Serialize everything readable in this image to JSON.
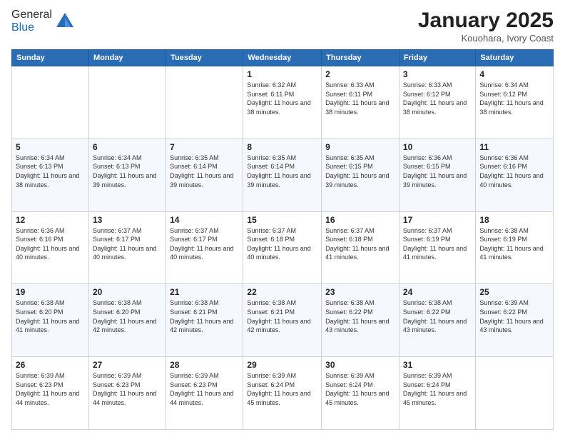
{
  "header": {
    "logo_general": "General",
    "logo_blue": "Blue",
    "month_title": "January 2025",
    "location": "Kouohara, Ivory Coast"
  },
  "days_of_week": [
    "Sunday",
    "Monday",
    "Tuesday",
    "Wednesday",
    "Thursday",
    "Friday",
    "Saturday"
  ],
  "weeks": [
    [
      {
        "day": "",
        "info": ""
      },
      {
        "day": "",
        "info": ""
      },
      {
        "day": "",
        "info": ""
      },
      {
        "day": "1",
        "info": "Sunrise: 6:32 AM\nSunset: 6:11 PM\nDaylight: 11 hours\nand 38 minutes."
      },
      {
        "day": "2",
        "info": "Sunrise: 6:33 AM\nSunset: 6:11 PM\nDaylight: 11 hours\nand 38 minutes."
      },
      {
        "day": "3",
        "info": "Sunrise: 6:33 AM\nSunset: 6:12 PM\nDaylight: 11 hours\nand 38 minutes."
      },
      {
        "day": "4",
        "info": "Sunrise: 6:34 AM\nSunset: 6:12 PM\nDaylight: 11 hours\nand 38 minutes."
      }
    ],
    [
      {
        "day": "5",
        "info": "Sunrise: 6:34 AM\nSunset: 6:13 PM\nDaylight: 11 hours\nand 38 minutes."
      },
      {
        "day": "6",
        "info": "Sunrise: 6:34 AM\nSunset: 6:13 PM\nDaylight: 11 hours\nand 39 minutes."
      },
      {
        "day": "7",
        "info": "Sunrise: 6:35 AM\nSunset: 6:14 PM\nDaylight: 11 hours\nand 39 minutes."
      },
      {
        "day": "8",
        "info": "Sunrise: 6:35 AM\nSunset: 6:14 PM\nDaylight: 11 hours\nand 39 minutes."
      },
      {
        "day": "9",
        "info": "Sunrise: 6:35 AM\nSunset: 6:15 PM\nDaylight: 11 hours\nand 39 minutes."
      },
      {
        "day": "10",
        "info": "Sunrise: 6:36 AM\nSunset: 6:15 PM\nDaylight: 11 hours\nand 39 minutes."
      },
      {
        "day": "11",
        "info": "Sunrise: 6:36 AM\nSunset: 6:16 PM\nDaylight: 11 hours\nand 40 minutes."
      }
    ],
    [
      {
        "day": "12",
        "info": "Sunrise: 6:36 AM\nSunset: 6:16 PM\nDaylight: 11 hours\nand 40 minutes."
      },
      {
        "day": "13",
        "info": "Sunrise: 6:37 AM\nSunset: 6:17 PM\nDaylight: 11 hours\nand 40 minutes."
      },
      {
        "day": "14",
        "info": "Sunrise: 6:37 AM\nSunset: 6:17 PM\nDaylight: 11 hours\nand 40 minutes."
      },
      {
        "day": "15",
        "info": "Sunrise: 6:37 AM\nSunset: 6:18 PM\nDaylight: 11 hours\nand 40 minutes."
      },
      {
        "day": "16",
        "info": "Sunrise: 6:37 AM\nSunset: 6:18 PM\nDaylight: 11 hours\nand 41 minutes."
      },
      {
        "day": "17",
        "info": "Sunrise: 6:37 AM\nSunset: 6:19 PM\nDaylight: 11 hours\nand 41 minutes."
      },
      {
        "day": "18",
        "info": "Sunrise: 6:38 AM\nSunset: 6:19 PM\nDaylight: 11 hours\nand 41 minutes."
      }
    ],
    [
      {
        "day": "19",
        "info": "Sunrise: 6:38 AM\nSunset: 6:20 PM\nDaylight: 11 hours\nand 41 minutes."
      },
      {
        "day": "20",
        "info": "Sunrise: 6:38 AM\nSunset: 6:20 PM\nDaylight: 11 hours\nand 42 minutes."
      },
      {
        "day": "21",
        "info": "Sunrise: 6:38 AM\nSunset: 6:21 PM\nDaylight: 11 hours\nand 42 minutes."
      },
      {
        "day": "22",
        "info": "Sunrise: 6:38 AM\nSunset: 6:21 PM\nDaylight: 11 hours\nand 42 minutes."
      },
      {
        "day": "23",
        "info": "Sunrise: 6:38 AM\nSunset: 6:22 PM\nDaylight: 11 hours\nand 43 minutes."
      },
      {
        "day": "24",
        "info": "Sunrise: 6:38 AM\nSunset: 6:22 PM\nDaylight: 11 hours\nand 43 minutes."
      },
      {
        "day": "25",
        "info": "Sunrise: 6:39 AM\nSunset: 6:22 PM\nDaylight: 11 hours\nand 43 minutes."
      }
    ],
    [
      {
        "day": "26",
        "info": "Sunrise: 6:39 AM\nSunset: 6:23 PM\nDaylight: 11 hours\nand 44 minutes."
      },
      {
        "day": "27",
        "info": "Sunrise: 6:39 AM\nSunset: 6:23 PM\nDaylight: 11 hours\nand 44 minutes."
      },
      {
        "day": "28",
        "info": "Sunrise: 6:39 AM\nSunset: 6:23 PM\nDaylight: 11 hours\nand 44 minutes."
      },
      {
        "day": "29",
        "info": "Sunrise: 6:39 AM\nSunset: 6:24 PM\nDaylight: 11 hours\nand 45 minutes."
      },
      {
        "day": "30",
        "info": "Sunrise: 6:39 AM\nSunset: 6:24 PM\nDaylight: 11 hours\nand 45 minutes."
      },
      {
        "day": "31",
        "info": "Sunrise: 6:39 AM\nSunset: 6:24 PM\nDaylight: 11 hours\nand 45 minutes."
      },
      {
        "day": "",
        "info": ""
      }
    ]
  ]
}
